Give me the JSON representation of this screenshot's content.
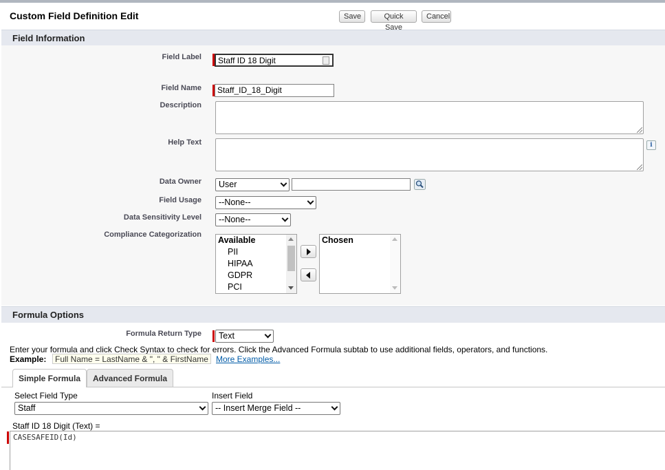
{
  "header": {
    "title": "Custom Field Definition Edit",
    "buttons": {
      "save": "Save",
      "quick_save": "Quick Save",
      "cancel": "Cancel"
    }
  },
  "field_information": {
    "section_title": "Field Information",
    "field_label": {
      "label": "Field Label",
      "value": "Staff ID 18 Digit"
    },
    "field_name": {
      "label": "Field Name",
      "value": "Staff_ID_18_Digit"
    },
    "description": {
      "label": "Description",
      "value": ""
    },
    "help_text": {
      "label": "Help Text",
      "value": ""
    },
    "data_owner": {
      "label": "Data Owner",
      "type_selected": "User",
      "value": ""
    },
    "field_usage": {
      "label": "Field Usage",
      "selected": "--None--"
    },
    "data_sensitivity": {
      "label": "Data Sensitivity Level",
      "selected": "--None--"
    },
    "compliance": {
      "label": "Compliance Categorization",
      "available_header": "Available",
      "available_items": [
        "PII",
        "HIPAA",
        "GDPR",
        "PCI"
      ],
      "chosen_header": "Chosen"
    }
  },
  "formula_options": {
    "section_title": "Formula Options",
    "return_type": {
      "label": "Formula Return Type",
      "selected": "Text"
    },
    "instructions": "Enter your formula and click Check Syntax to check for errors. Click the Advanced Formula subtab to use additional fields, operators, and functions.",
    "example_label": "Example:",
    "example_value": "Full Name = LastName & \", \" & FirstName",
    "more_examples": "More Examples...",
    "tabs": [
      "Simple Formula",
      "Advanced Formula"
    ],
    "select_field_type": {
      "label": "Select Field Type",
      "selected": "Staff"
    },
    "insert_field": {
      "label": "Insert Field",
      "selected": "-- Insert Merge Field --"
    },
    "formula_header": "Staff ID 18 Digit (Text) =",
    "formula_text": "CASESAFEID(Id)"
  },
  "colors": {
    "section_bg": "#e5e8ef",
    "required": "#cc0000",
    "link": "#015ba7"
  },
  "icons": [
    "lookup-search-icon",
    "info-icon",
    "move-right-icon",
    "move-left-icon",
    "chevron-down-icon"
  ]
}
